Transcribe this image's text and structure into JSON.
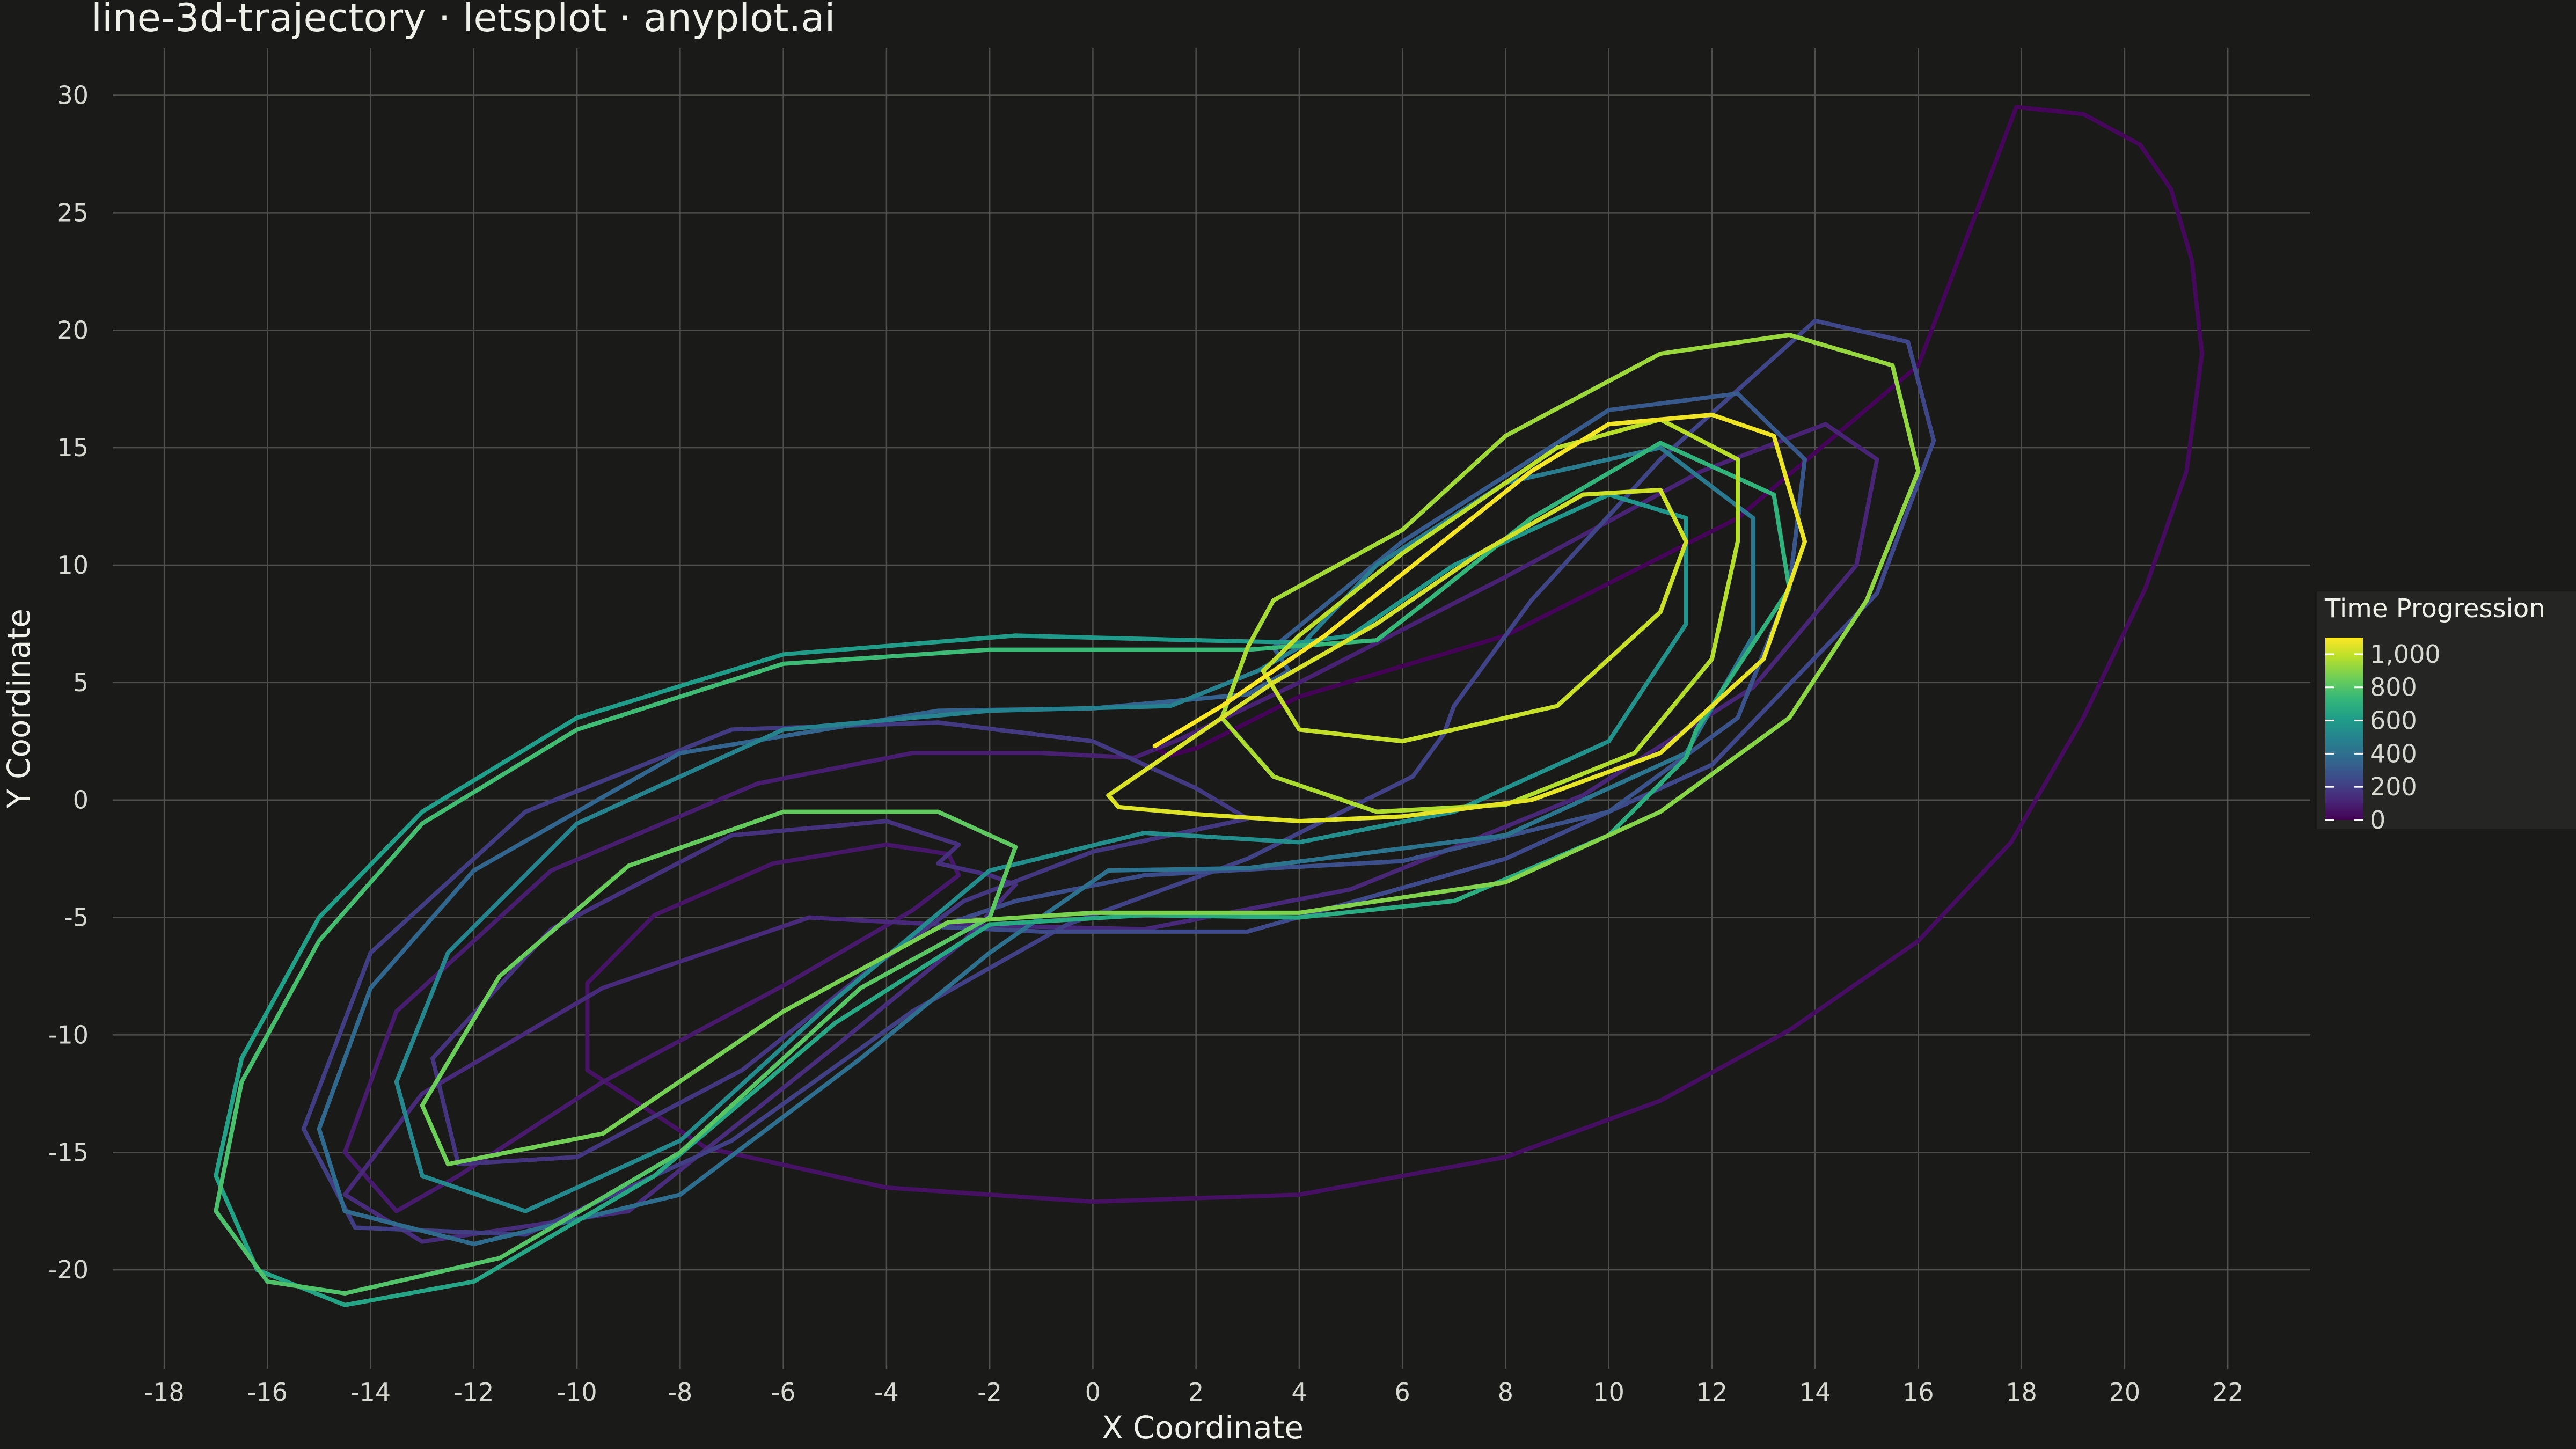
{
  "colors": {
    "background": "#1a1a18",
    "grid": "#4e4e4b",
    "text": "#d8d8d2",
    "legend_bg": "#252523",
    "viridis": [
      "#440154",
      "#482878",
      "#3e4a89",
      "#31688e",
      "#26828e",
      "#1f9e89",
      "#35b779",
      "#6ece58",
      "#b5de2b",
      "#fde725"
    ]
  },
  "chart_data": {
    "type": "line",
    "title": "line-3d-trajectory · letsplot · anyplot.ai",
    "xlabel": "X Coordinate",
    "ylabel": "Y Coordinate",
    "xlim": [
      -19.0,
      23.6
    ],
    "ylim": [
      -24.2,
      32.0
    ],
    "x_ticks": [
      -18,
      -16,
      -14,
      -12,
      -10,
      -8,
      -6,
      -4,
      -2,
      0,
      2,
      4,
      6,
      8,
      10,
      12,
      14,
      16,
      18,
      20,
      22
    ],
    "y_ticks": [
      -20,
      -15,
      -10,
      -5,
      0,
      5,
      10,
      15,
      20,
      25,
      30
    ],
    "grid": true,
    "color_variable": "Time Progression",
    "color_range": [
      0,
      1100
    ],
    "legend": {
      "title": "Time Progression",
      "position": "right",
      "ticks": [
        1000,
        800,
        600,
        400,
        200,
        0
      ],
      "tick_labels": [
        "1,000",
        "800",
        "600",
        "400",
        "200",
        "0"
      ]
    },
    "series": [
      {
        "t_start": 0,
        "t_end": 150,
        "points": [
          [
            1.2,
            2.2
          ],
          [
            1.5,
            1.9
          ],
          [
            2.0,
            2.2
          ],
          [
            4.0,
            4.4
          ],
          [
            8.0,
            7.0
          ],
          [
            12.5,
            12.0
          ],
          [
            16.0,
            18.5
          ],
          [
            17.9,
            29.5
          ],
          [
            19.2,
            29.2
          ],
          [
            20.3,
            27.9
          ],
          [
            20.9,
            26.0
          ],
          [
            21.3,
            23.0
          ],
          [
            21.5,
            19.0
          ],
          [
            21.2,
            14.0
          ],
          [
            20.4,
            9.0
          ],
          [
            19.2,
            3.5
          ],
          [
            17.8,
            -1.8
          ],
          [
            16.0,
            -6.0
          ],
          [
            13.5,
            -9.8
          ],
          [
            11.0,
            -12.8
          ],
          [
            8.0,
            -15.2
          ],
          [
            4.0,
            -16.8
          ],
          [
            0.0,
            -17.1
          ],
          [
            -4.0,
            -16.5
          ],
          [
            -7.5,
            -14.8
          ],
          [
            -9.8,
            -11.5
          ],
          [
            -9.8,
            -7.8
          ],
          [
            -8.5,
            -4.9
          ],
          [
            -6.2,
            -2.7
          ],
          [
            -4.0,
            -1.9
          ],
          [
            -2.8,
            -2.3
          ],
          [
            -2.6,
            -3.2
          ],
          [
            -3.5,
            -4.7
          ],
          [
            -6.0,
            -7.9
          ],
          [
            -9.5,
            -12.0
          ],
          [
            -12.3,
            -16.0
          ],
          [
            -13.5,
            -17.5
          ],
          [
            -14.5,
            -15.0
          ],
          [
            -13.5,
            -9.0
          ],
          [
            -10.5,
            -3.0
          ],
          [
            -6.5,
            0.7
          ],
          [
            -3.5,
            2.0
          ],
          [
            -1.0,
            2.0
          ],
          [
            0.8,
            1.8
          ],
          [
            1.7,
            2.6
          ],
          [
            4.0,
            5.0
          ],
          [
            8.0,
            9.5
          ],
          [
            11.8,
            14.0
          ],
          [
            14.2,
            16.0
          ],
          [
            15.2,
            14.5
          ],
          [
            14.8,
            10.0
          ],
          [
            12.8,
            4.8
          ],
          [
            9.5,
            0.2
          ],
          [
            5.0,
            -3.8
          ],
          [
            1.0,
            -5.5
          ],
          [
            -3.0,
            -5.3
          ],
          [
            -5.5,
            -5.0
          ],
          [
            -9.5,
            -8.0
          ],
          [
            -13.0,
            -12.5
          ],
          [
            -14.5,
            -16.8
          ],
          [
            -13.0,
            -18.8
          ],
          [
            -9.0,
            -17.5
          ],
          [
            -5.0,
            -10.5
          ],
          [
            -2.5,
            -6.0
          ],
          [
            -1.5,
            -3.6
          ],
          [
            -2.0,
            -3.2
          ],
          [
            -3.0,
            -2.7
          ]
        ]
      },
      {
        "t_start": 150,
        "t_end": 250,
        "points": [
          [
            -3.0,
            -2.7
          ],
          [
            -2.6,
            -1.9
          ],
          [
            -4.0,
            -0.9
          ],
          [
            -7.0,
            -1.5
          ],
          [
            -10.5,
            -5.5
          ],
          [
            -12.8,
            -11.0
          ],
          [
            -12.3,
            -15.5
          ],
          [
            -10.0,
            -15.2
          ],
          [
            -6.8,
            -11.5
          ],
          [
            -4.5,
            -7.5
          ],
          [
            -2.5,
            -4.3
          ],
          [
            0.0,
            -2.2
          ],
          [
            3.0,
            -0.8
          ],
          [
            2.0,
            0.5
          ],
          [
            0.0,
            2.5
          ],
          [
            -3.0,
            3.3
          ],
          [
            -7.0,
            3.0
          ],
          [
            -11.0,
            -0.5
          ],
          [
            -14.0,
            -6.5
          ],
          [
            -15.3,
            -14.0
          ],
          [
            -14.3,
            -18.2
          ],
          [
            -11.0,
            -18.5
          ],
          [
            -7.0,
            -14.5
          ],
          [
            -3.5,
            -9.0
          ],
          [
            -0.5,
            -5.3
          ],
          [
            3.0,
            -2.5
          ],
          [
            6.2,
            1.0
          ],
          [
            6.8,
            2.8
          ],
          [
            7.0,
            4.0
          ],
          [
            8.5,
            8.5
          ],
          [
            11.0,
            14.5
          ],
          [
            14.0,
            20.4
          ],
          [
            15.8,
            19.5
          ],
          [
            16.3,
            15.3
          ],
          [
            15.2,
            8.8
          ],
          [
            12.0,
            1.5
          ],
          [
            8.0,
            -2.5
          ],
          [
            3.0,
            -5.6
          ],
          [
            -1.0,
            -5.6
          ],
          [
            -3.0,
            -5.4
          ]
        ]
      },
      {
        "t_start": 250,
        "t_end": 470,
        "points": [
          [
            -3.0,
            -5.4
          ],
          [
            -1.5,
            -4.3
          ],
          [
            1.0,
            -3.2
          ],
          [
            6.0,
            -2.6
          ],
          [
            10.0,
            -0.5
          ],
          [
            12.5,
            3.5
          ],
          [
            13.5,
            9.0
          ],
          [
            13.8,
            14.5
          ],
          [
            12.5,
            17.3
          ],
          [
            10.0,
            16.6
          ],
          [
            6.0,
            11.0
          ],
          [
            3.5,
            6.5
          ],
          [
            3.8,
            5.5
          ],
          [
            3.0,
            4.5
          ],
          [
            0.0,
            3.9
          ],
          [
            -3.0,
            3.8
          ],
          [
            -8.0,
            2.0
          ],
          [
            -12.0,
            -3.0
          ],
          [
            -14.0,
            -8.0
          ],
          [
            -15.0,
            -14.0
          ],
          [
            -14.5,
            -17.5
          ],
          [
            -12.0,
            -18.9
          ],
          [
            -8.0,
            -16.8
          ],
          [
            -4.5,
            -11.0
          ],
          [
            -2.0,
            -6.5
          ],
          [
            0.3,
            -3.0
          ],
          [
            3.0,
            -2.9
          ],
          [
            8.0,
            -1.5
          ],
          [
            11.5,
            2.0
          ],
          [
            12.8,
            7.0
          ],
          [
            12.8,
            12.0
          ],
          [
            11.0,
            15.0
          ],
          [
            8.0,
            13.5
          ],
          [
            5.5,
            10.0
          ],
          [
            4.0,
            6.5
          ]
        ]
      },
      {
        "t_start": 470,
        "t_end": 700,
        "points": [
          [
            4.0,
            6.5
          ],
          [
            3.2,
            5.5
          ],
          [
            1.5,
            4.0
          ],
          [
            -2.0,
            3.8
          ],
          [
            -6.0,
            3.0
          ],
          [
            -10.0,
            -1.0
          ],
          [
            -12.5,
            -6.5
          ],
          [
            -13.5,
            -12.0
          ],
          [
            -13.0,
            -16.0
          ],
          [
            -11.0,
            -17.5
          ],
          [
            -8.0,
            -14.5
          ],
          [
            -5.0,
            -8.5
          ],
          [
            -2.0,
            -3.0
          ],
          [
            1.0,
            -1.4
          ],
          [
            4.0,
            -1.8
          ],
          [
            7.0,
            -0.5
          ],
          [
            10.0,
            2.5
          ],
          [
            11.5,
            7.5
          ],
          [
            11.5,
            12.0
          ],
          [
            10.0,
            13.0
          ],
          [
            7.0,
            10.0
          ],
          [
            5.0,
            7.0
          ],
          [
            4.0,
            6.7
          ],
          [
            2.0,
            6.8
          ],
          [
            -1.5,
            7.0
          ],
          [
            -6.0,
            6.2
          ],
          [
            -10.0,
            3.5
          ],
          [
            -13.0,
            -0.5
          ],
          [
            -15.0,
            -5.0
          ],
          [
            -16.5,
            -11.0
          ],
          [
            -17.0,
            -16.0
          ],
          [
            -16.2,
            -20.0
          ],
          [
            -14.5,
            -21.5
          ],
          [
            -12.0,
            -20.5
          ],
          [
            -8.5,
            -16.0
          ],
          [
            -5.0,
            -9.5
          ],
          [
            -2.0,
            -5.3
          ],
          [
            1.0,
            -4.9
          ],
          [
            4.0,
            -5.0
          ],
          [
            7.0,
            -4.3
          ],
          [
            10.0,
            -1.5
          ],
          [
            11.5,
            1.8
          ],
          [
            11.7,
            3.0
          ],
          [
            12.0,
            4.0
          ]
        ]
      },
      {
        "t_start": 700,
        "t_end": 950,
        "points": [
          [
            12.0,
            4.0
          ],
          [
            13.5,
            9.0
          ],
          [
            13.2,
            13.0
          ],
          [
            11.0,
            15.2
          ],
          [
            8.5,
            12.0
          ],
          [
            6.5,
            8.5
          ],
          [
            5.5,
            6.8
          ],
          [
            3.0,
            6.4
          ],
          [
            -2.0,
            6.4
          ],
          [
            -6.0,
            5.8
          ],
          [
            -10.0,
            3.0
          ],
          [
            -13.0,
            -1.0
          ],
          [
            -15.0,
            -6.0
          ],
          [
            -16.5,
            -12.0
          ],
          [
            -17.0,
            -17.5
          ],
          [
            -16.0,
            -20.5
          ],
          [
            -14.5,
            -21.0
          ],
          [
            -11.5,
            -19.5
          ],
          [
            -8.0,
            -15.0
          ],
          [
            -4.5,
            -8.0
          ],
          [
            -2.0,
            -5.0
          ],
          [
            -1.5,
            -2.0
          ],
          [
            -3.0,
            -0.5
          ],
          [
            -6.0,
            -0.5
          ],
          [
            -9.0,
            -2.8
          ],
          [
            -11.5,
            -7.5
          ],
          [
            -13.0,
            -13.0
          ],
          [
            -12.5,
            -15.5
          ],
          [
            -9.5,
            -14.2
          ],
          [
            -6.0,
            -9.0
          ],
          [
            -2.8,
            -5.2
          ],
          [
            0.0,
            -4.8
          ],
          [
            4.0,
            -4.8
          ],
          [
            8.0,
            -3.5
          ],
          [
            11.0,
            -0.5
          ],
          [
            13.5,
            3.5
          ],
          [
            15.0,
            8.5
          ],
          [
            16.0,
            14.0
          ],
          [
            15.5,
            18.5
          ],
          [
            13.5,
            19.8
          ],
          [
            11.0,
            19.0
          ],
          [
            8.0,
            15.5
          ],
          [
            6.0,
            11.5
          ],
          [
            3.5,
            8.5
          ]
        ]
      },
      {
        "t_start": 950,
        "t_end": 1100,
        "points": [
          [
            3.5,
            8.5
          ],
          [
            3.0,
            6.5
          ],
          [
            2.5,
            3.5
          ],
          [
            3.5,
            1.0
          ],
          [
            5.5,
            -0.5
          ],
          [
            8.0,
            -0.2
          ],
          [
            10.5,
            2.0
          ],
          [
            12.0,
            6.0
          ],
          [
            12.5,
            11.0
          ],
          [
            12.5,
            14.5
          ],
          [
            11.0,
            16.2
          ],
          [
            9.0,
            15.0
          ],
          [
            6.0,
            10.5
          ],
          [
            4.0,
            7.0
          ],
          [
            3.3,
            5.5
          ],
          [
            4.0,
            3.0
          ],
          [
            6.0,
            2.5
          ],
          [
            9.0,
            4.0
          ],
          [
            11.0,
            8.0
          ],
          [
            11.5,
            11.0
          ],
          [
            11.0,
            13.2
          ],
          [
            9.5,
            13.0
          ],
          [
            7.5,
            10.5
          ],
          [
            5.5,
            7.5
          ],
          [
            3.5,
            5.0
          ],
          [
            1.5,
            2.0
          ],
          [
            0.3,
            0.2
          ],
          [
            0.5,
            -0.3
          ],
          [
            2.0,
            -0.6
          ],
          [
            4.0,
            -0.9
          ],
          [
            6.0,
            -0.7
          ],
          [
            8.5,
            0.0
          ],
          [
            11.0,
            2.0
          ],
          [
            13.0,
            6.0
          ],
          [
            13.8,
            11.0
          ],
          [
            13.2,
            15.5
          ],
          [
            12.0,
            16.4
          ],
          [
            10.0,
            16.0
          ],
          [
            8.5,
            14.0
          ],
          [
            6.5,
            10.5
          ],
          [
            4.5,
            7.0
          ],
          [
            3.5,
            5.5
          ],
          [
            2.5,
            4.0
          ],
          [
            1.2,
            2.3
          ]
        ]
      }
    ]
  }
}
